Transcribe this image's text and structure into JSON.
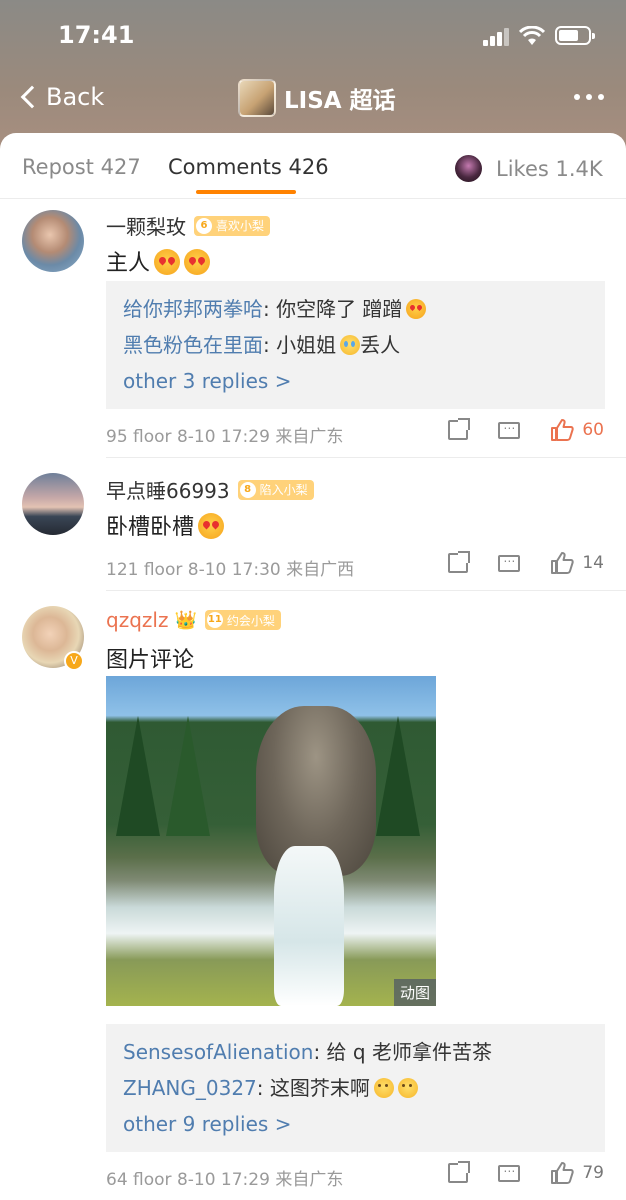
{
  "status_bar": {
    "time": "17:41"
  },
  "nav": {
    "back_label": "Back",
    "topic_title": "LISA 超话"
  },
  "tabs": {
    "repost": "Repost 427",
    "comments": "Comments 426",
    "likes": "Likes 1.4K",
    "active": "comments",
    "accent_color": "#ff8200"
  },
  "comments": [
    {
      "username": "一颗梨玫",
      "badge_level": "6",
      "badge_text": "喜欢小梨",
      "text": "主人",
      "emojis": [
        "heart-eyes",
        "heart-eyes"
      ],
      "replies": [
        {
          "name": "给你邦邦两拳哈",
          "text": ": 你空降了 蹭蹭"
        },
        {
          "name": "黑色粉色在里面",
          "text": ": 小姐姐",
          "text2": "丢人"
        }
      ],
      "more_replies": "other 3 replies >",
      "meta": "95 floor 8-10 17:29 来自广东",
      "likes": "60",
      "liked": true
    },
    {
      "username": "早点睡66993",
      "badge_level": "8",
      "badge_text": "陷入小梨",
      "text": "卧槽卧槽",
      "emojis": [
        "heart-eyes"
      ],
      "meta": "121 floor 8-10 17:30 来自广西",
      "likes": "14",
      "liked": false
    },
    {
      "username": "qzqzlz",
      "verified": true,
      "badge_level": "11",
      "badge_text": "约会小梨",
      "text": "图片评论",
      "image_tag": "动图",
      "replies": [
        {
          "name": "SensesofAlienation",
          "text": ": 给 q 老师拿件苦茶"
        },
        {
          "name": "ZHANG_0327",
          "text": ": 这图芥末啊"
        }
      ],
      "more_replies": "other 9 replies >",
      "meta": "64 floor 8-10 17:29 来自广东",
      "likes": "79",
      "liked": false
    }
  ],
  "colors": {
    "link_blue": "#507daf",
    "liked_orange": "#eb7350",
    "vip_name_orange": "#eb7350"
  }
}
